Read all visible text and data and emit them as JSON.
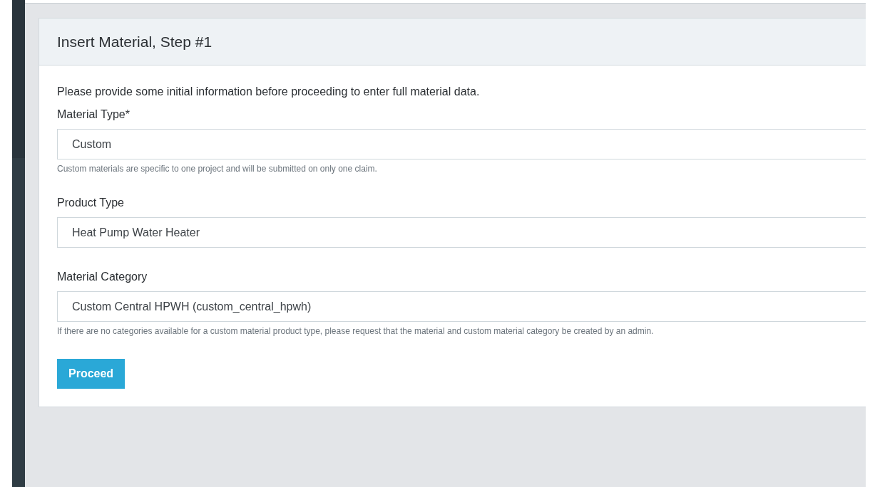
{
  "card": {
    "title": "Insert Material, Step #1",
    "intro": "Please provide some initial information before proceeding to enter full material data.",
    "fields": [
      {
        "label": "Material Type*",
        "value": "Custom",
        "help": "Custom materials are specific to one project and will be submitted on only one claim."
      },
      {
        "label": "Product Type",
        "value": "Heat Pump Water Heater"
      },
      {
        "label": "Material Category",
        "value": "Custom Central HPWH (custom_central_hpwh)",
        "help": "If there are no categories available for a custom material product type, please request that the material and custom material category be created by an admin."
      }
    ],
    "button": "Proceed"
  }
}
